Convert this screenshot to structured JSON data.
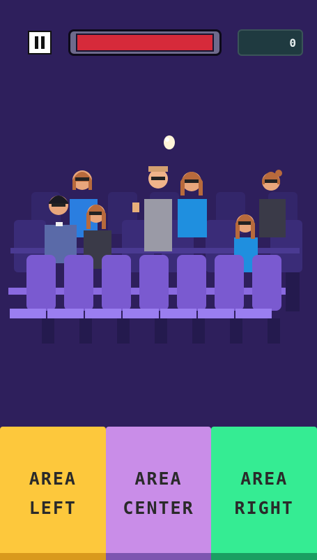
{
  "hud": {
    "pause_icon": "pause-icon",
    "health_level": 1.0,
    "health_color": "#d62a3a",
    "score": "0"
  },
  "scene": {
    "background": "#2e1f5c",
    "seat_color": "#7a5ad0",
    "seat_back_color": "#3c2d7a",
    "popcorn_icon": "popcorn-icon"
  },
  "controls": {
    "left": {
      "line1": "AREA",
      "line2": "LEFT",
      "color": "#fdc83c"
    },
    "center": {
      "line1": "AREA",
      "line2": "CENTER",
      "color": "#c98de8"
    },
    "right": {
      "line1": "AREA",
      "line2": "RIGHT",
      "color": "#35ec93"
    }
  }
}
